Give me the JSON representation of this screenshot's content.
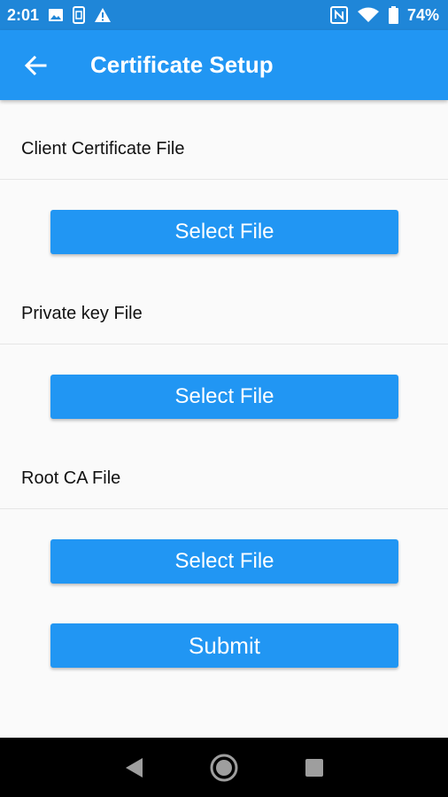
{
  "status_bar": {
    "time": "2:01",
    "battery_percent": "74%",
    "icons": [
      "image-icon",
      "sim-icon",
      "warning-icon",
      "nfc-icon",
      "wifi-icon",
      "battery-icon"
    ]
  },
  "app_bar": {
    "title": "Certificate Setup",
    "back_icon": "arrow-left-icon"
  },
  "sections": [
    {
      "label": "Client Certificate File",
      "button_label": "Select File"
    },
    {
      "label": "Private key File",
      "button_label": "Select File"
    },
    {
      "label": "Root CA File",
      "button_label": "Select File"
    }
  ],
  "submit_label": "Submit",
  "nav_bar": {
    "icons": [
      "back-triangle-icon",
      "home-circle-icon",
      "recents-square-icon"
    ]
  },
  "colors": {
    "status_bar": "#1f86d8",
    "primary": "#2196f3",
    "background": "#fafafa",
    "nav_bar": "#000000"
  }
}
